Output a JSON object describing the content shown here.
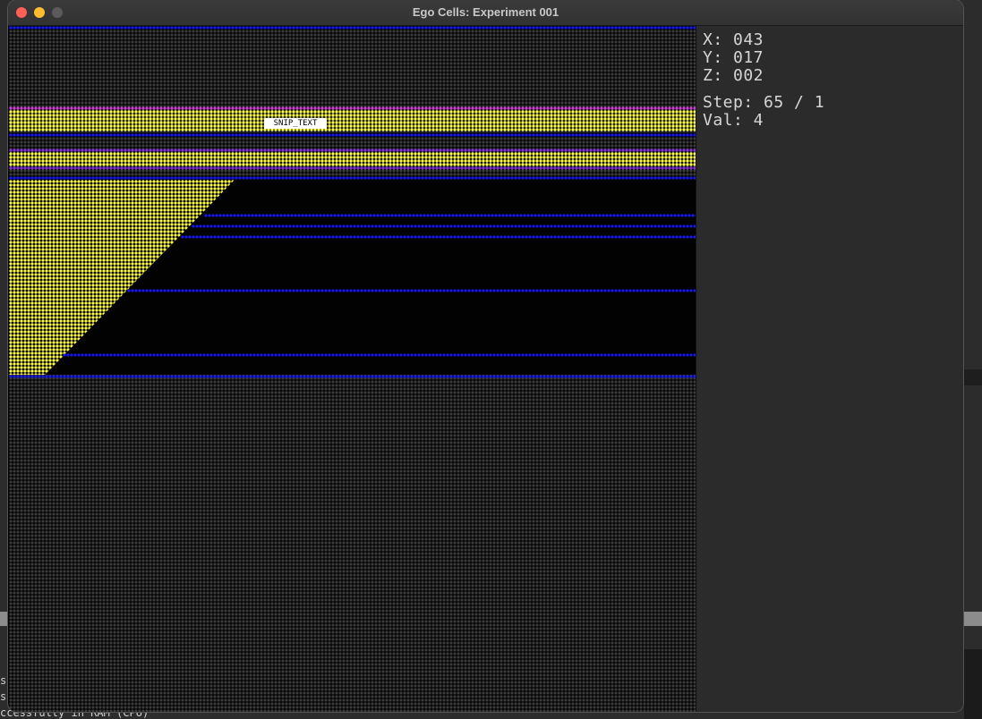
{
  "window": {
    "title": "Ego Cells: Experiment 001"
  },
  "canvas": {
    "label": "SNIP_TEXT",
    "colors": {
      "background_dot": "#3c3c3c",
      "blue": "#1616ff",
      "magenta": "#e03be6",
      "purple": "#8a30e8",
      "yellow": "#ffff3c"
    }
  },
  "panel": {
    "x": "X: 043",
    "y": "Y: 017",
    "z": "Z: 002",
    "step": "Step: 65 / 1",
    "val": "Val: 4"
  },
  "background_terminal": {
    "line1": "s",
    "line2": "s",
    "line3": "ccessfully in RAM (CPU)"
  },
  "icons": [
    "close-icon",
    "minimize-icon",
    "maximize-icon"
  ]
}
